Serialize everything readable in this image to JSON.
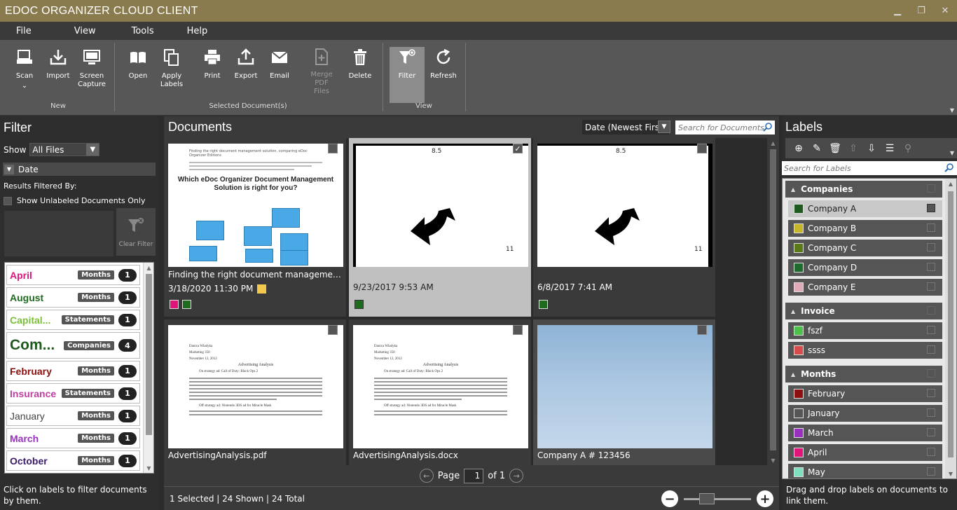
{
  "window": {
    "title": "EDOC ORGANIZER CLOUD CLIENT"
  },
  "menu": [
    "File",
    "View",
    "Tools",
    "Help"
  ],
  "ribbon": {
    "groups": {
      "new": {
        "label": "New",
        "buttons": [
          {
            "label": "Scan",
            "icon": "scanner-icon"
          },
          {
            "label": "Import",
            "icon": "import-icon"
          },
          {
            "label": "Screen\nCapture",
            "icon": "screen-capture-icon"
          }
        ]
      },
      "selected": {
        "label": "Selected Document(s)",
        "buttons": [
          {
            "label": "Open",
            "icon": "book-icon"
          },
          {
            "label": "Apply\nLabels",
            "icon": "apply-labels-icon"
          },
          {
            "label": "Print",
            "icon": "printer-icon"
          },
          {
            "label": "Export",
            "icon": "export-icon"
          },
          {
            "label": "Email",
            "icon": "envelope-icon"
          },
          {
            "label": "Merge PDF\nFiles",
            "icon": "merge-pdf-icon"
          },
          {
            "label": "Delete",
            "icon": "trash-icon"
          }
        ]
      },
      "view": {
        "label": "View",
        "buttons": [
          {
            "label": "Filter",
            "icon": "filter-add-icon"
          },
          {
            "label": "Refresh",
            "icon": "refresh-icon"
          }
        ]
      }
    }
  },
  "filter": {
    "title": "Filter",
    "show_label": "Show",
    "show_value": "All Files",
    "date_header": "Date",
    "results_filtered_by": "Results Filtered By:",
    "unlabeled": "Show Unlabeled Documents Only",
    "clear_filter": "Clear Filter",
    "cloud": [
      {
        "name": "April",
        "category": "Months",
        "count": "1",
        "color": "#e0157a"
      },
      {
        "name": "August",
        "category": "Months",
        "count": "1",
        "color": "#1f6b1f"
      },
      {
        "name": "Capital...",
        "category": "Statements",
        "count": "1",
        "color": "#7bbf3a"
      },
      {
        "name": "Com...",
        "category": "Companies",
        "count": "4",
        "color": "#1f5a1f"
      },
      {
        "name": "February",
        "category": "Months",
        "count": "1",
        "color": "#8b1010"
      },
      {
        "name": "Insurance",
        "category": "Statements",
        "count": "1",
        "color": "#c040a0"
      },
      {
        "name": "January",
        "category": "Months",
        "count": "1",
        "color": "#444444"
      },
      {
        "name": "March",
        "category": "Months",
        "count": "1",
        "color": "#9a30c0"
      },
      {
        "name": "October",
        "category": "Months",
        "count": "1",
        "color": "#3a1a6a"
      }
    ],
    "help": "Click on labels to filter documents by them."
  },
  "documents": {
    "title": "Documents",
    "sort": "Date (Newest First)",
    "search_placeholder": "Search for Documents",
    "cards": [
      {
        "name": "Finding the right document management sol...",
        "date": "3/18/2020 11:30 PM",
        "swatches": [
          "#e0157a",
          "#1f6b1f"
        ],
        "note": true,
        "selected": false
      },
      {
        "name": "",
        "date": "9/23/2017 9:53 AM",
        "swatches": [
          "#1f6b1f"
        ],
        "selected": true
      },
      {
        "name": "",
        "date": "6/8/2017 7:41 AM",
        "swatches": [
          "#1f6b1f"
        ],
        "selected": false
      },
      {
        "name": "AdvertisingAnalysis.pdf",
        "date": "",
        "swatches": [],
        "selected": false
      },
      {
        "name": "AdvertisingAnalysis.docx",
        "date": "",
        "swatches": [],
        "selected": false
      },
      {
        "name": "Company A # 123456",
        "date": "",
        "swatches": [],
        "selected": false
      }
    ],
    "thumb_text": {
      "doc1_line1": "Finding the right document management solution, comparing eDoc Organizer Editions",
      "doc1_title": "Which eDoc Organizer Document Management Solution is right for you?",
      "page_size": "8.5",
      "page_num": "11",
      "adv_name": "Danica Wladyka",
      "adv_course": "Marketing 350",
      "adv_date": "November 12, 2012",
      "adv_title": "Advertising Analysis",
      "adv_sub": "On strategy ad: Call of Duty: Black Ops 2",
      "adv_sub2": "Off strategy ad: Nintendo 3DS ad for Miracle Mask"
    },
    "pager": {
      "page_label": "Page",
      "page": "1",
      "of_label": "of 1"
    },
    "status": "1 Selected | 24 Shown | 24 Total",
    "zoom": 0.3
  },
  "labels": {
    "title": "Labels",
    "search_placeholder": "Search for Labels",
    "groups": [
      {
        "name": "Companies",
        "items": [
          {
            "name": "Company A",
            "color": "#1f5a1f",
            "selected": true
          },
          {
            "name": "Company B",
            "color": "#c6b62a"
          },
          {
            "name": "Company C",
            "color": "#5a7a1a"
          },
          {
            "name": "Company D",
            "color": "#1f6b2f"
          },
          {
            "name": "Company E",
            "color": "#e0aab8"
          }
        ]
      },
      {
        "name": "Invoice",
        "items": [
          {
            "name": "fszf",
            "color": "#4cc24c"
          },
          {
            "name": "ssss",
            "color": "#d94c4c"
          }
        ]
      },
      {
        "name": "Months",
        "items": [
          {
            "name": "February",
            "color": "#8b1010"
          },
          {
            "name": "January",
            "color": "#555555"
          },
          {
            "name": "March",
            "color": "#9a30c0"
          },
          {
            "name": "April",
            "color": "#e0157a"
          },
          {
            "name": "May",
            "color": "#7fe0c0"
          }
        ]
      }
    ],
    "help": "Drag and drop labels on documents to link them."
  }
}
